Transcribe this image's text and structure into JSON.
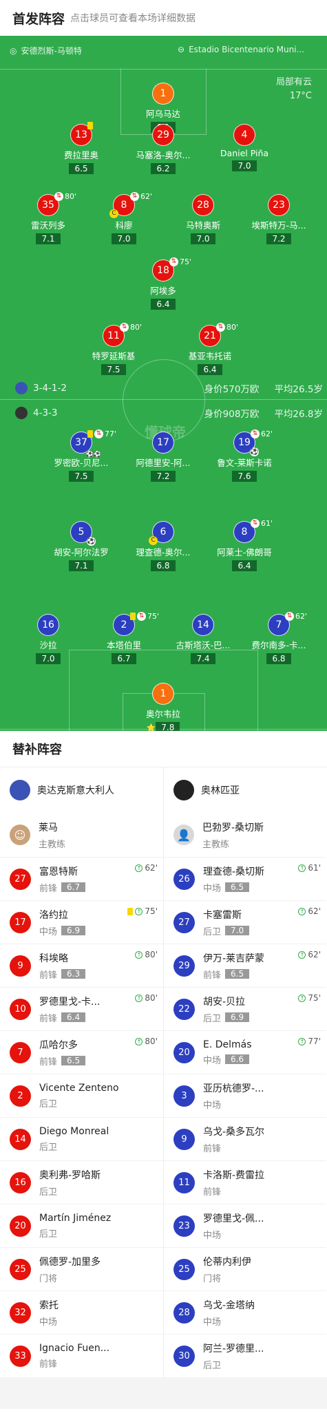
{
  "header": {
    "title": "首发阵容",
    "subtitle": "点击球员可查看本场详细数据"
  },
  "venue": {
    "coach": "安德烈斯-马顿特",
    "stadium": "Estadio Bicentenario Muni...",
    "weather": "局部有云",
    "temp": "17°C"
  },
  "home": {
    "formation": "3-4-1-2",
    "value": "身价570万欧",
    "age": "平均26.5岁",
    "color": "#e5130c",
    "players": [
      {
        "num": "1",
        "name": "阿乌马达",
        "rating": "6.1",
        "gk": true
      },
      {
        "num": "13",
        "name": "费拉里奥",
        "rating": "6.5",
        "yellow": true
      },
      {
        "num": "29",
        "name": "马塞洛-奥尔...",
        "rating": "6.2"
      },
      {
        "num": "4",
        "name": "Daniel Piña",
        "rating": "7.0"
      },
      {
        "num": "35",
        "name": "雷沃列多",
        "rating": "7.1",
        "sub": "80'"
      },
      {
        "num": "8",
        "name": "科廖",
        "rating": "7.0",
        "sub": "62'",
        "captain": true
      },
      {
        "num": "28",
        "name": "马特奥斯",
        "rating": "7.0"
      },
      {
        "num": "23",
        "name": "埃斯特万-马...",
        "rating": "7.2"
      },
      {
        "num": "18",
        "name": "阿埃多",
        "rating": "6.4",
        "sub": "75'"
      },
      {
        "num": "11",
        "name": "特罗延斯基",
        "rating": "7.5",
        "sub": "80'"
      },
      {
        "num": "21",
        "name": "基亚韦托诺",
        "rating": "6.4",
        "sub": "80'"
      }
    ]
  },
  "away": {
    "formation": "4-3-3",
    "value": "身价908万欧",
    "age": "平均26.8岁",
    "color": "#2c3fc1",
    "players": [
      {
        "num": "37",
        "name": "罗密欧-贝尼...",
        "rating": "7.5",
        "yellow": true,
        "sub": "77'",
        "assist": "⚽⚽"
      },
      {
        "num": "17",
        "name": "阿德里安-阿...",
        "rating": "7.2"
      },
      {
        "num": "19",
        "name": "鲁文-莱斯卡诺",
        "rating": "7.6",
        "sub": "62'",
        "goal": true
      },
      {
        "num": "5",
        "name": "胡安-阿尔法罗",
        "rating": "7.1",
        "goal": true
      },
      {
        "num": "6",
        "name": "理查德-奥尔...",
        "rating": "6.8",
        "captain": true
      },
      {
        "num": "8",
        "name": "阿莱士-佛朗哥",
        "rating": "6.4",
        "sub": "61'"
      },
      {
        "num": "16",
        "name": "沙拉",
        "rating": "7.0"
      },
      {
        "num": "2",
        "name": "本塔伯里",
        "rating": "6.7",
        "yellow": true,
        "sub": "75'"
      },
      {
        "num": "14",
        "name": "古斯塔沃-巴...",
        "rating": "7.4"
      },
      {
        "num": "7",
        "name": "费尔南多-卡...",
        "rating": "6.8",
        "sub": "62'"
      },
      {
        "num": "1",
        "name": "奥尔韦拉",
        "rating": "7.8",
        "gk": true,
        "star": true
      }
    ]
  },
  "logo_text": "懂球帝",
  "subs_title": "替补阵容",
  "subs": {
    "home": {
      "team": "奥达克斯意大利人",
      "coach": "莱马",
      "coach_role": "主教练",
      "list": [
        {
          "num": "27",
          "name": "富恩特斯",
          "pos": "前锋",
          "rating": "6.7",
          "in": "62'"
        },
        {
          "num": "17",
          "name": "洛约拉",
          "pos": "中场",
          "rating": "6.9",
          "in": "75'",
          "yellow": true
        },
        {
          "num": "9",
          "name": "科埃略",
          "pos": "前锋",
          "rating": "6.3",
          "in": "80'"
        },
        {
          "num": "10",
          "name": "罗德里戈-卡...",
          "pos": "前锋",
          "rating": "6.4",
          "in": "80'"
        },
        {
          "num": "7",
          "name": "瓜哈尔多",
          "pos": "前锋",
          "rating": "6.5",
          "in": "80'"
        },
        {
          "num": "2",
          "name": "Vicente Zenteno",
          "pos": "后卫"
        },
        {
          "num": "14",
          "name": "Diego Monreal",
          "pos": "后卫"
        },
        {
          "num": "16",
          "name": "奥利弗-罗哈斯",
          "pos": "后卫"
        },
        {
          "num": "20",
          "name": "Martín Jiménez",
          "pos": "后卫"
        },
        {
          "num": "25",
          "name": "佩德罗-加里多",
          "pos": "门将"
        },
        {
          "num": "32",
          "name": "索托",
          "pos": "中场"
        },
        {
          "num": "33",
          "name": "Ignacio Fuen...",
          "pos": "前锋"
        }
      ]
    },
    "away": {
      "team": "奥林匹亚",
      "coach": "巴勃罗-桑切斯",
      "coach_role": "主教练",
      "list": [
        {
          "num": "26",
          "name": "理查德-桑切斯",
          "pos": "中场",
          "rating": "6.5",
          "in": "61'"
        },
        {
          "num": "27",
          "name": "卡塞雷斯",
          "pos": "后卫",
          "rating": "7.0",
          "in": "62'"
        },
        {
          "num": "29",
          "name": "伊万-莱吉萨蒙",
          "pos": "前锋",
          "rating": "6.5",
          "in": "62'"
        },
        {
          "num": "22",
          "name": "胡安-贝拉",
          "pos": "后卫",
          "rating": "6.9",
          "in": "75'"
        },
        {
          "num": "20",
          "name": "E. Delmás",
          "pos": "中场",
          "rating": "6.6",
          "in": "77'"
        },
        {
          "num": "3",
          "name": "亚历杭德罗-...",
          "pos": "中场"
        },
        {
          "num": "9",
          "name": "乌戈-桑多瓦尔",
          "pos": "前锋"
        },
        {
          "num": "11",
          "name": "卡洛斯-费雷拉",
          "pos": "前锋"
        },
        {
          "num": "23",
          "name": "罗德里戈-佩...",
          "pos": "中场"
        },
        {
          "num": "25",
          "name": "伦蒂内利伊",
          "pos": "门将"
        },
        {
          "num": "28",
          "name": "乌戈-金塔纳",
          "pos": "中场"
        },
        {
          "num": "30",
          "name": "阿兰-罗德里...",
          "pos": "后卫"
        }
      ]
    }
  }
}
